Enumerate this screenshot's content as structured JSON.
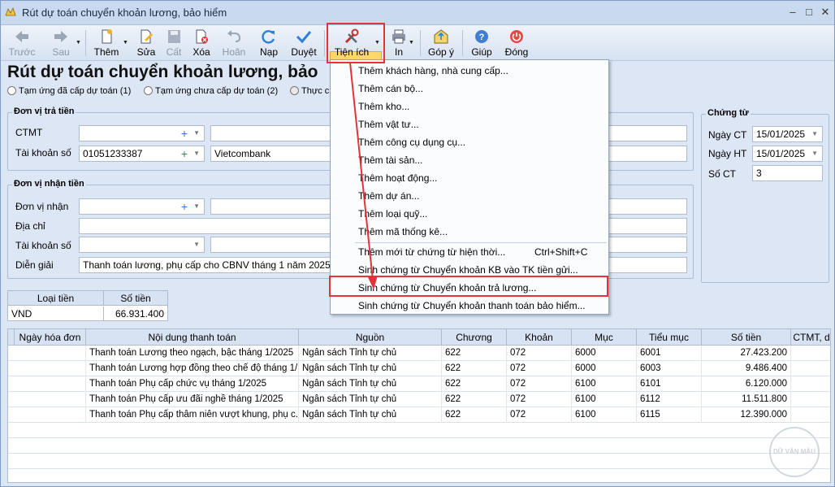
{
  "window": {
    "title": "Rút dự toán chuyển khoản lương, bảo hiểm",
    "controls": [
      "–",
      "□",
      "✕"
    ]
  },
  "toolbar": {
    "back": "Trước",
    "next": "Sau",
    "add": "Thêm",
    "edit": "Sửa",
    "save": "Cất",
    "delete": "Xóa",
    "undo": "Hoãn",
    "reload": "Nạp",
    "approve": "Duyệt",
    "utilities": "Tiện ích",
    "print": "In",
    "feedback": "Góp ý",
    "help": "Giúp",
    "close": "Đóng"
  },
  "page": {
    "heading": "Rút dự toán chuyển khoản lương, bảo"
  },
  "options": {
    "opt1": "Tạm ứng đã cấp dự toán (1)",
    "opt2": "Tạm ứng chưa cấp dự toán (2)",
    "opt3": "Thực c"
  },
  "payer": {
    "group_label": "Đơn vị trả tiền",
    "ctmt_label": "CTMT",
    "ctmt_value": "",
    "account_label": "Tài khoản số",
    "account_value": "01051233387",
    "bank_value": "Vietcombank"
  },
  "payee": {
    "group_label": "Đơn vị nhận tiền",
    "unit_label": "Đơn vị nhận",
    "address_label": "Địa chỉ",
    "account_label": "Tài khoản số",
    "description_label": "Diễn giải",
    "description_value": "Thanh toán lương, phụ cấp cho CBNV tháng 1 năm 2025"
  },
  "voucher": {
    "group_label": "Chứng từ",
    "date_ct_label": "Ngày CT",
    "date_ct_value": "15/01/2025",
    "date_ht_label": "Ngày HT",
    "date_ht_value": "15/01/2025",
    "number_label": "Số CT",
    "number_value": "3"
  },
  "currency_table": {
    "col_currency": "Loại tiền",
    "col_amount": "Số tiền",
    "currency": "VND",
    "amount": "66.931.400"
  },
  "grid": {
    "headers": [
      "Ngày hóa đơn",
      "Nội dung thanh toán",
      "Nguồn",
      "Chương",
      "Khoản",
      "Mục",
      "Tiểu mục",
      "Số tiền",
      "CTMT, d"
    ],
    "rows": [
      {
        "content": "Thanh toán Lương theo ngạch, bậc tháng 1/2025",
        "source": "Ngân sách Tỉnh tự chủ",
        "chapter": "622",
        "item": "072",
        "section": "6000",
        "subsection": "6001",
        "amount": "27.423.200"
      },
      {
        "content": "Thanh toán Lương hợp đồng theo chế độ tháng 1/...",
        "source": "Ngân sách Tỉnh tự chủ",
        "chapter": "622",
        "item": "072",
        "section": "6000",
        "subsection": "6003",
        "amount": "9.486.400"
      },
      {
        "content": "Thanh toán Phụ cấp chức vụ tháng 1/2025",
        "source": "Ngân sách Tỉnh tự chủ",
        "chapter": "622",
        "item": "072",
        "section": "6100",
        "subsection": "6101",
        "amount": "6.120.000"
      },
      {
        "content": "Thanh toán Phụ cấp ưu đãi nghề tháng 1/2025",
        "source": "Ngân sách Tỉnh tự chủ",
        "chapter": "622",
        "item": "072",
        "section": "6100",
        "subsection": "6112",
        "amount": "11.511.800"
      },
      {
        "content": "Thanh toán Phụ cấp thâm niên vượt khung, phụ c...",
        "source": "Ngân sách Tỉnh tự chủ",
        "chapter": "622",
        "item": "072",
        "section": "6100",
        "subsection": "6115",
        "amount": "12.390.000"
      }
    ]
  },
  "menu": {
    "items": [
      "Thêm khách hàng, nhà cung cấp...",
      "Thêm cán bộ...",
      "Thêm kho...",
      "Thêm vật tư...",
      "Thêm công cụ dụng cụ...",
      "Thêm tài sản...",
      "Thêm hoạt động...",
      "Thêm dự án...",
      "Thêm loại quỹ...",
      "Thêm mã thống kê..."
    ],
    "new_from_current": "Thêm mới từ chứng từ hiện thời...",
    "new_from_current_shortcut": "Ctrl+Shift+C",
    "gen_kb_transfer": "Sinh chứng từ Chuyển khoản KB vào TK tiền gửi...",
    "gen_payroll_transfer": "Sinh chứng từ Chuyển khoản trả lương...",
    "gen_insurance_transfer": "Sinh chứng từ Chuyển khoản thanh toán bảo hiểm..."
  },
  "colors": {
    "annotation": "#e3343c",
    "highlight": "#ffd76c"
  },
  "watermark": "DỮ VĂN MẪU"
}
